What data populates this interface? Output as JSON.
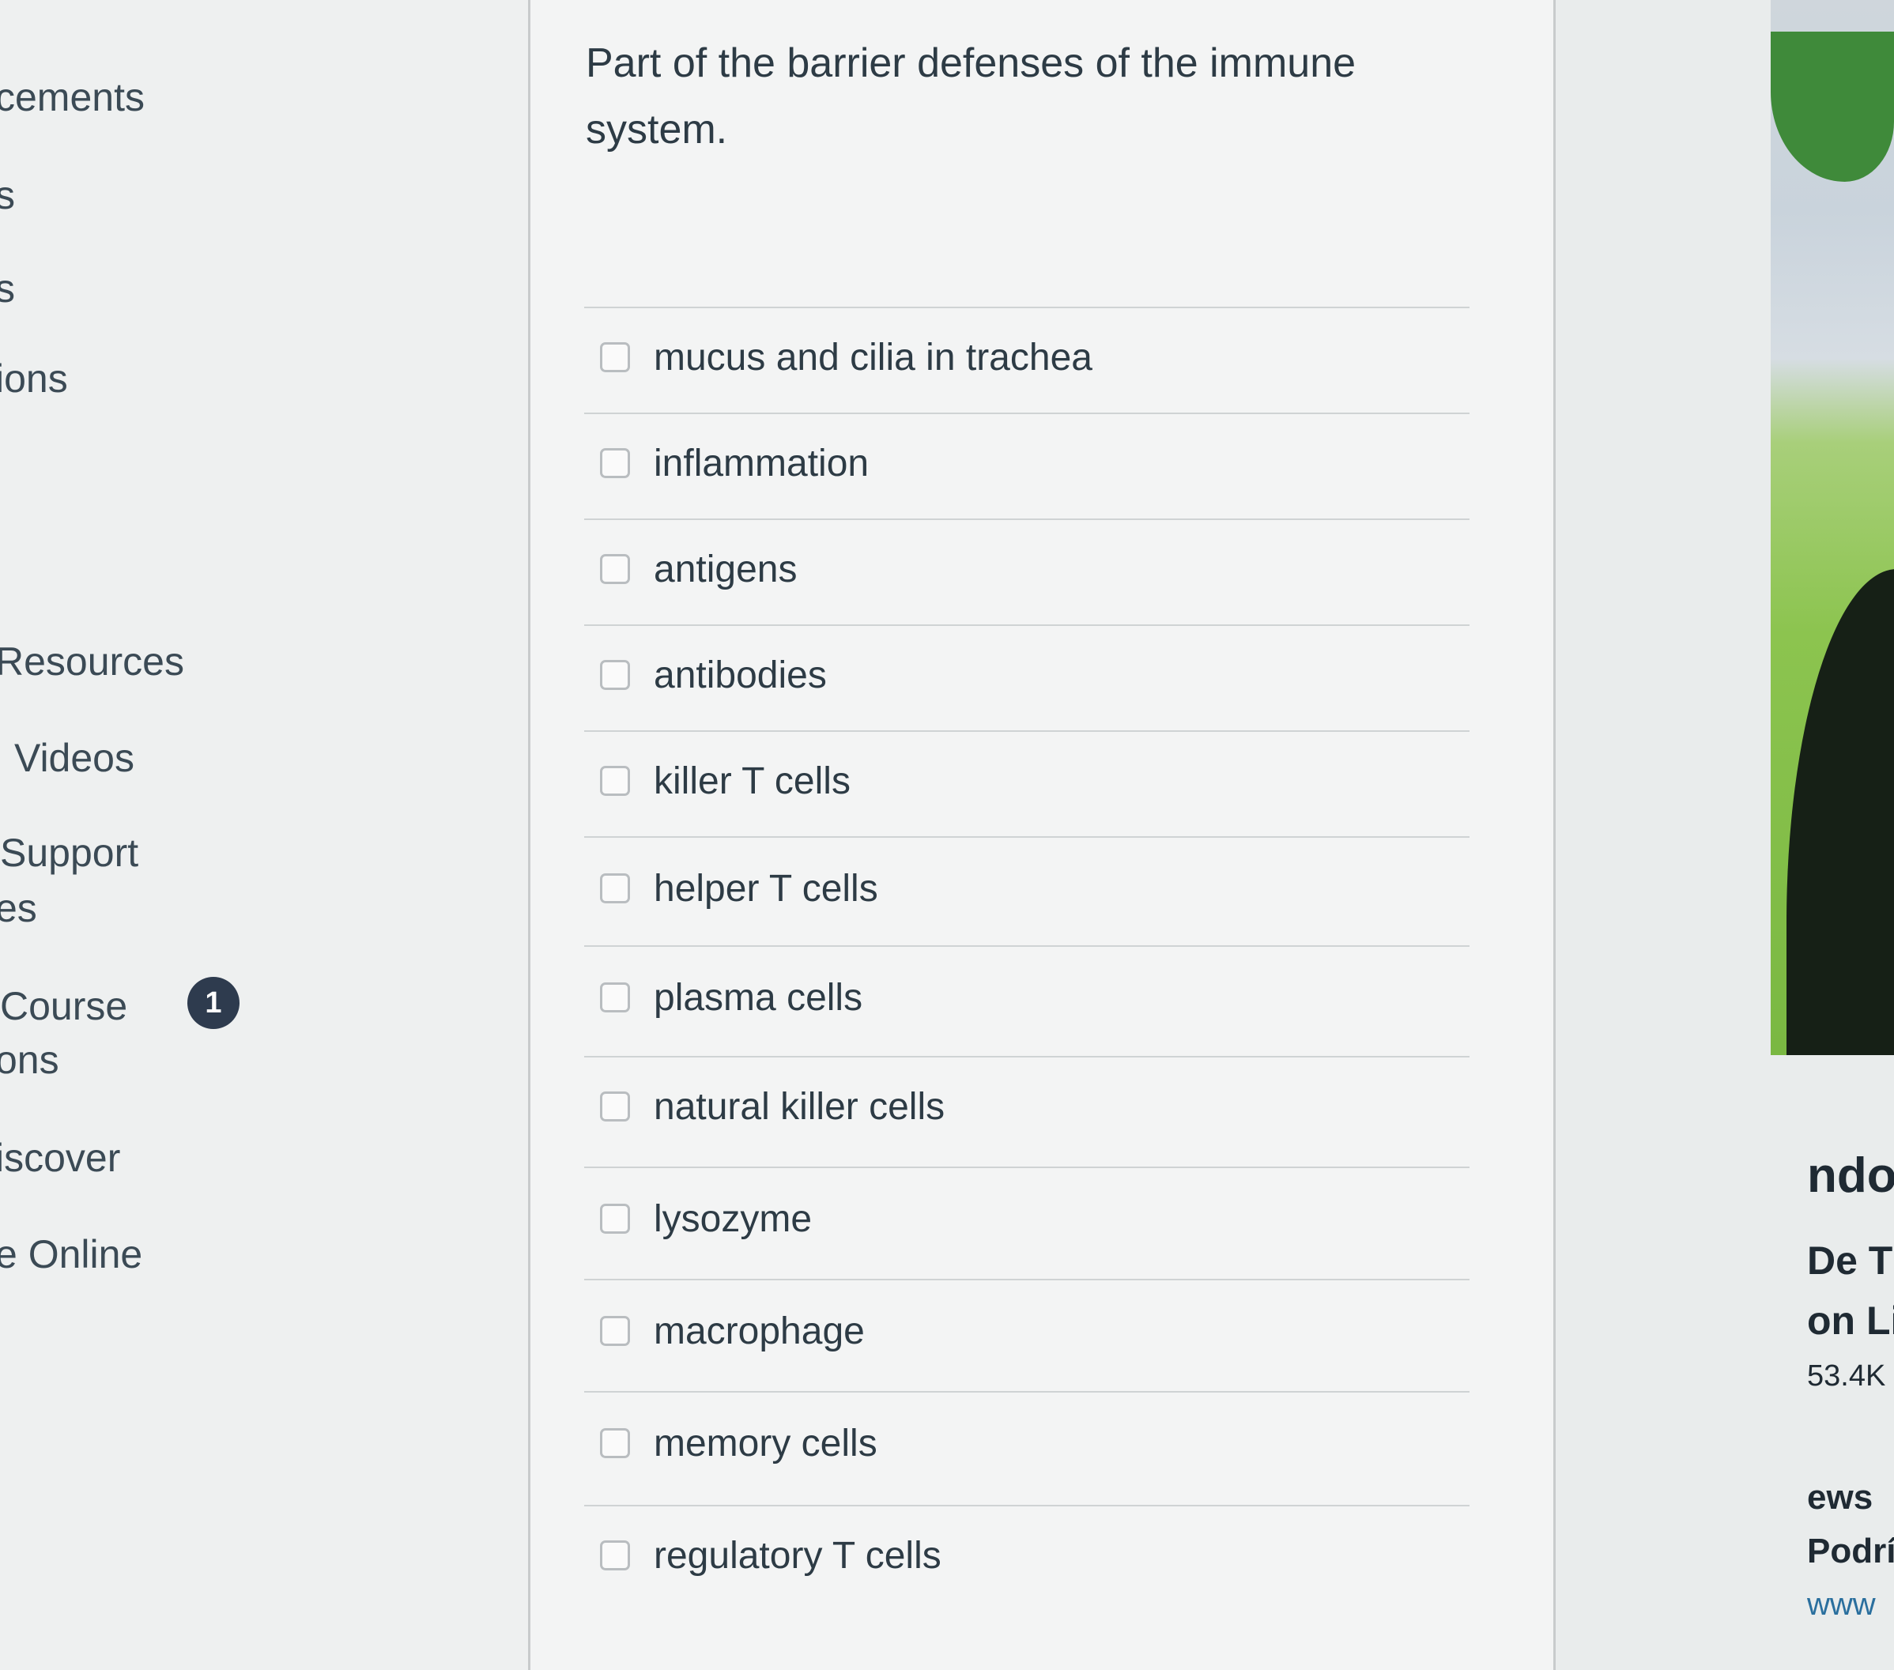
{
  "sidebar": {
    "items": [
      {
        "label": "cements"
      },
      {
        "label": "s"
      },
      {
        "label": "s"
      },
      {
        "label": "ions"
      },
      {
        "label": "Resources"
      },
      {
        "label": "Videos"
      },
      {
        "label": "Support"
      },
      {
        "label": "es"
      },
      {
        "label": "Course"
      },
      {
        "label": "ons"
      },
      {
        "label": "iscover"
      },
      {
        "label": "e Online"
      }
    ],
    "badge": "1"
  },
  "question": {
    "text": "Part of the barrier defenses of the immune system.",
    "answers": [
      {
        "label": "mucus and cilia in trachea",
        "checked": false
      },
      {
        "label": "inflammation",
        "checked": false
      },
      {
        "label": "antigens",
        "checked": false
      },
      {
        "label": "antibodies",
        "checked": false
      },
      {
        "label": "killer T cells",
        "checked": false
      },
      {
        "label": "helper T cells",
        "checked": false
      },
      {
        "label": "plasma cells",
        "checked": false
      },
      {
        "label": "natural killer cells",
        "checked": false
      },
      {
        "label": "lysozyme",
        "checked": false
      },
      {
        "label": "macrophage",
        "checked": false
      },
      {
        "label": "memory cells",
        "checked": false
      },
      {
        "label": "regulatory T cells",
        "checked": false
      }
    ]
  },
  "right_panel": {
    "texts": [
      "ndo",
      "De T",
      "on Li",
      "53.4K",
      "ews",
      "Podrí",
      "www"
    ]
  },
  "colors": {
    "text": "#2d3b45",
    "badge": "#2e3b4e",
    "checkbox_border": "#b9bdc0",
    "divider": "#cfd3d4"
  }
}
